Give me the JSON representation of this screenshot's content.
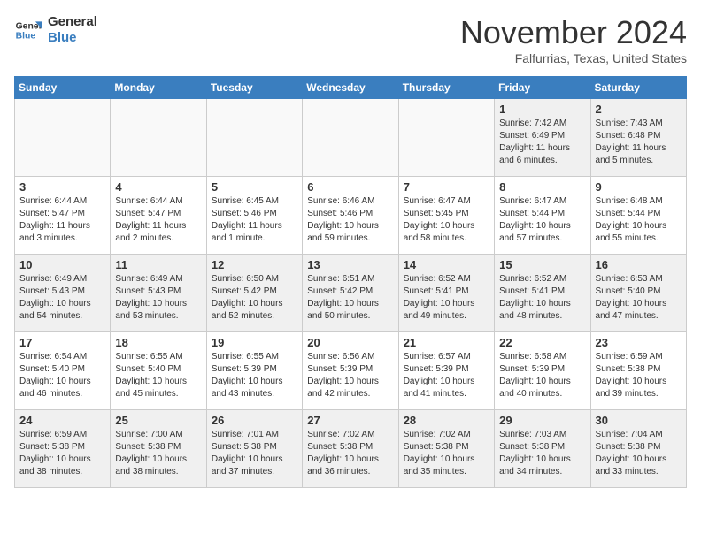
{
  "header": {
    "logo_line1": "General",
    "logo_line2": "Blue",
    "month": "November 2024",
    "location": "Falfurrias, Texas, United States"
  },
  "weekdays": [
    "Sunday",
    "Monday",
    "Tuesday",
    "Wednesday",
    "Thursday",
    "Friday",
    "Saturday"
  ],
  "weeks": [
    [
      {
        "day": "",
        "empty": true
      },
      {
        "day": "",
        "empty": true
      },
      {
        "day": "",
        "empty": true
      },
      {
        "day": "",
        "empty": true
      },
      {
        "day": "",
        "empty": true
      },
      {
        "day": "1",
        "lines": [
          "Sunrise: 7:42 AM",
          "Sunset: 6:49 PM",
          "Daylight: 11 hours",
          "and 6 minutes."
        ]
      },
      {
        "day": "2",
        "lines": [
          "Sunrise: 7:43 AM",
          "Sunset: 6:48 PM",
          "Daylight: 11 hours",
          "and 5 minutes."
        ]
      }
    ],
    [
      {
        "day": "3",
        "lines": [
          "Sunrise: 6:44 AM",
          "Sunset: 5:47 PM",
          "Daylight: 11 hours",
          "and 3 minutes."
        ]
      },
      {
        "day": "4",
        "lines": [
          "Sunrise: 6:44 AM",
          "Sunset: 5:47 PM",
          "Daylight: 11 hours",
          "and 2 minutes."
        ]
      },
      {
        "day": "5",
        "lines": [
          "Sunrise: 6:45 AM",
          "Sunset: 5:46 PM",
          "Daylight: 11 hours",
          "and 1 minute."
        ]
      },
      {
        "day": "6",
        "lines": [
          "Sunrise: 6:46 AM",
          "Sunset: 5:46 PM",
          "Daylight: 10 hours",
          "and 59 minutes."
        ]
      },
      {
        "day": "7",
        "lines": [
          "Sunrise: 6:47 AM",
          "Sunset: 5:45 PM",
          "Daylight: 10 hours",
          "and 58 minutes."
        ]
      },
      {
        "day": "8",
        "lines": [
          "Sunrise: 6:47 AM",
          "Sunset: 5:44 PM",
          "Daylight: 10 hours",
          "and 57 minutes."
        ]
      },
      {
        "day": "9",
        "lines": [
          "Sunrise: 6:48 AM",
          "Sunset: 5:44 PM",
          "Daylight: 10 hours",
          "and 55 minutes."
        ]
      }
    ],
    [
      {
        "day": "10",
        "lines": [
          "Sunrise: 6:49 AM",
          "Sunset: 5:43 PM",
          "Daylight: 10 hours",
          "and 54 minutes."
        ]
      },
      {
        "day": "11",
        "lines": [
          "Sunrise: 6:49 AM",
          "Sunset: 5:43 PM",
          "Daylight: 10 hours",
          "and 53 minutes."
        ]
      },
      {
        "day": "12",
        "lines": [
          "Sunrise: 6:50 AM",
          "Sunset: 5:42 PM",
          "Daylight: 10 hours",
          "and 52 minutes."
        ]
      },
      {
        "day": "13",
        "lines": [
          "Sunrise: 6:51 AM",
          "Sunset: 5:42 PM",
          "Daylight: 10 hours",
          "and 50 minutes."
        ]
      },
      {
        "day": "14",
        "lines": [
          "Sunrise: 6:52 AM",
          "Sunset: 5:41 PM",
          "Daylight: 10 hours",
          "and 49 minutes."
        ]
      },
      {
        "day": "15",
        "lines": [
          "Sunrise: 6:52 AM",
          "Sunset: 5:41 PM",
          "Daylight: 10 hours",
          "and 48 minutes."
        ]
      },
      {
        "day": "16",
        "lines": [
          "Sunrise: 6:53 AM",
          "Sunset: 5:40 PM",
          "Daylight: 10 hours",
          "and 47 minutes."
        ]
      }
    ],
    [
      {
        "day": "17",
        "lines": [
          "Sunrise: 6:54 AM",
          "Sunset: 5:40 PM",
          "Daylight: 10 hours",
          "and 46 minutes."
        ]
      },
      {
        "day": "18",
        "lines": [
          "Sunrise: 6:55 AM",
          "Sunset: 5:40 PM",
          "Daylight: 10 hours",
          "and 45 minutes."
        ]
      },
      {
        "day": "19",
        "lines": [
          "Sunrise: 6:55 AM",
          "Sunset: 5:39 PM",
          "Daylight: 10 hours",
          "and 43 minutes."
        ]
      },
      {
        "day": "20",
        "lines": [
          "Sunrise: 6:56 AM",
          "Sunset: 5:39 PM",
          "Daylight: 10 hours",
          "and 42 minutes."
        ]
      },
      {
        "day": "21",
        "lines": [
          "Sunrise: 6:57 AM",
          "Sunset: 5:39 PM",
          "Daylight: 10 hours",
          "and 41 minutes."
        ]
      },
      {
        "day": "22",
        "lines": [
          "Sunrise: 6:58 AM",
          "Sunset: 5:39 PM",
          "Daylight: 10 hours",
          "and 40 minutes."
        ]
      },
      {
        "day": "23",
        "lines": [
          "Sunrise: 6:59 AM",
          "Sunset: 5:38 PM",
          "Daylight: 10 hours",
          "and 39 minutes."
        ]
      }
    ],
    [
      {
        "day": "24",
        "lines": [
          "Sunrise: 6:59 AM",
          "Sunset: 5:38 PM",
          "Daylight: 10 hours",
          "and 38 minutes."
        ]
      },
      {
        "day": "25",
        "lines": [
          "Sunrise: 7:00 AM",
          "Sunset: 5:38 PM",
          "Daylight: 10 hours",
          "and 38 minutes."
        ]
      },
      {
        "day": "26",
        "lines": [
          "Sunrise: 7:01 AM",
          "Sunset: 5:38 PM",
          "Daylight: 10 hours",
          "and 37 minutes."
        ]
      },
      {
        "day": "27",
        "lines": [
          "Sunrise: 7:02 AM",
          "Sunset: 5:38 PM",
          "Daylight: 10 hours",
          "and 36 minutes."
        ]
      },
      {
        "day": "28",
        "lines": [
          "Sunrise: 7:02 AM",
          "Sunset: 5:38 PM",
          "Daylight: 10 hours",
          "and 35 minutes."
        ]
      },
      {
        "day": "29",
        "lines": [
          "Sunrise: 7:03 AM",
          "Sunset: 5:38 PM",
          "Daylight: 10 hours",
          "and 34 minutes."
        ]
      },
      {
        "day": "30",
        "lines": [
          "Sunrise: 7:04 AM",
          "Sunset: 5:38 PM",
          "Daylight: 10 hours",
          "and 33 minutes."
        ]
      }
    ]
  ]
}
